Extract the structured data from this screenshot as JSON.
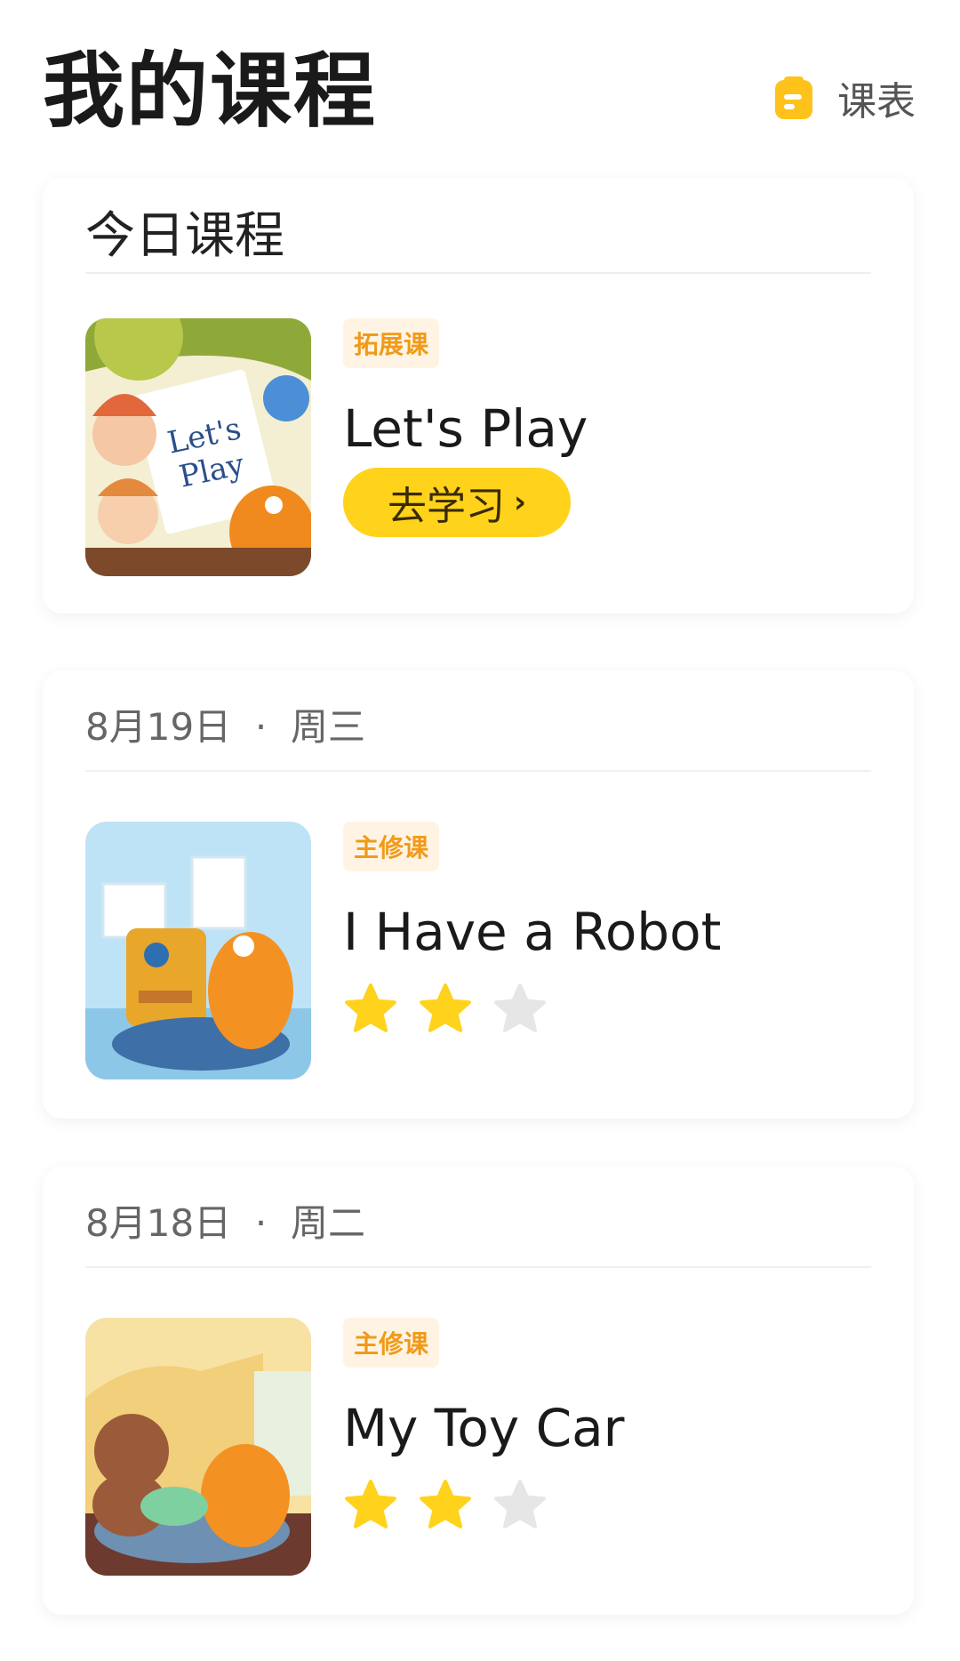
{
  "header": {
    "title": "我的课程",
    "schedule_label": "课表",
    "schedule_icon": "calendar-icon"
  },
  "today": {
    "section_title": "今日课程",
    "lesson": {
      "tag": "拓展课",
      "title": "Let's Play",
      "button_label": "去学习",
      "button_chevron": "›",
      "thumbnail_text": "Let's Play"
    }
  },
  "history": [
    {
      "date": "8月19日",
      "weekday": "周三",
      "lesson": {
        "tag": "主修课",
        "title": "I Have a Robot",
        "stars_earned": 2,
        "stars_total": 3
      }
    },
    {
      "date": "8月18日",
      "weekday": "周二",
      "lesson": {
        "tag": "主修课",
        "title": "My Toy Car",
        "stars_earned": 2,
        "stars_total": 3
      }
    }
  ],
  "colors": {
    "accent_yellow": "#ffd21c",
    "tag_text": "#f09a1a",
    "tag_bg": "#fff4e3",
    "star_on": "#ffd21c",
    "star_off": "#e6e6e6"
  }
}
